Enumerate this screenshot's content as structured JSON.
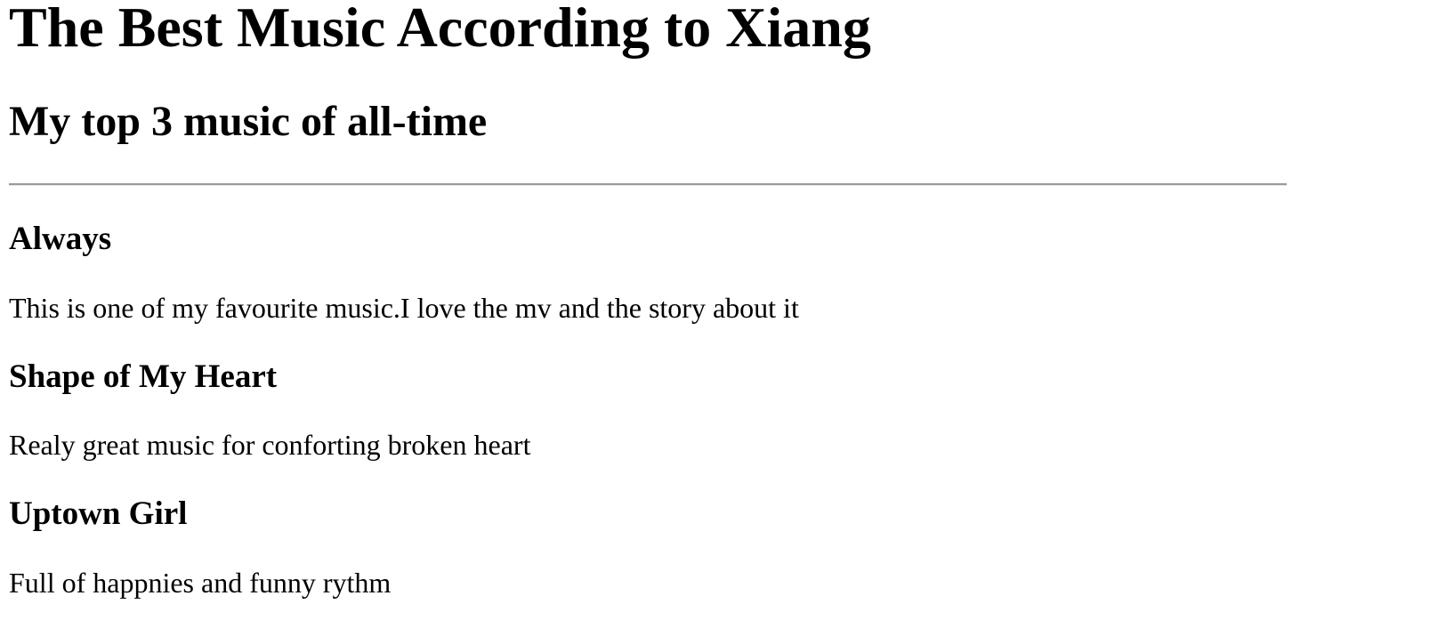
{
  "page": {
    "title": "The Best Music According to Xiang",
    "subtitle": "My top 3 music of all-time"
  },
  "songs": [
    {
      "title": "Always",
      "description": "This is one of my favourite music.I love the mv and the story about it"
    },
    {
      "title": "Shape of My Heart",
      "description": "Realy great music for conforting broken heart"
    },
    {
      "title": "Uptown Girl",
      "description": "Full of happnies and funny rythm"
    }
  ]
}
